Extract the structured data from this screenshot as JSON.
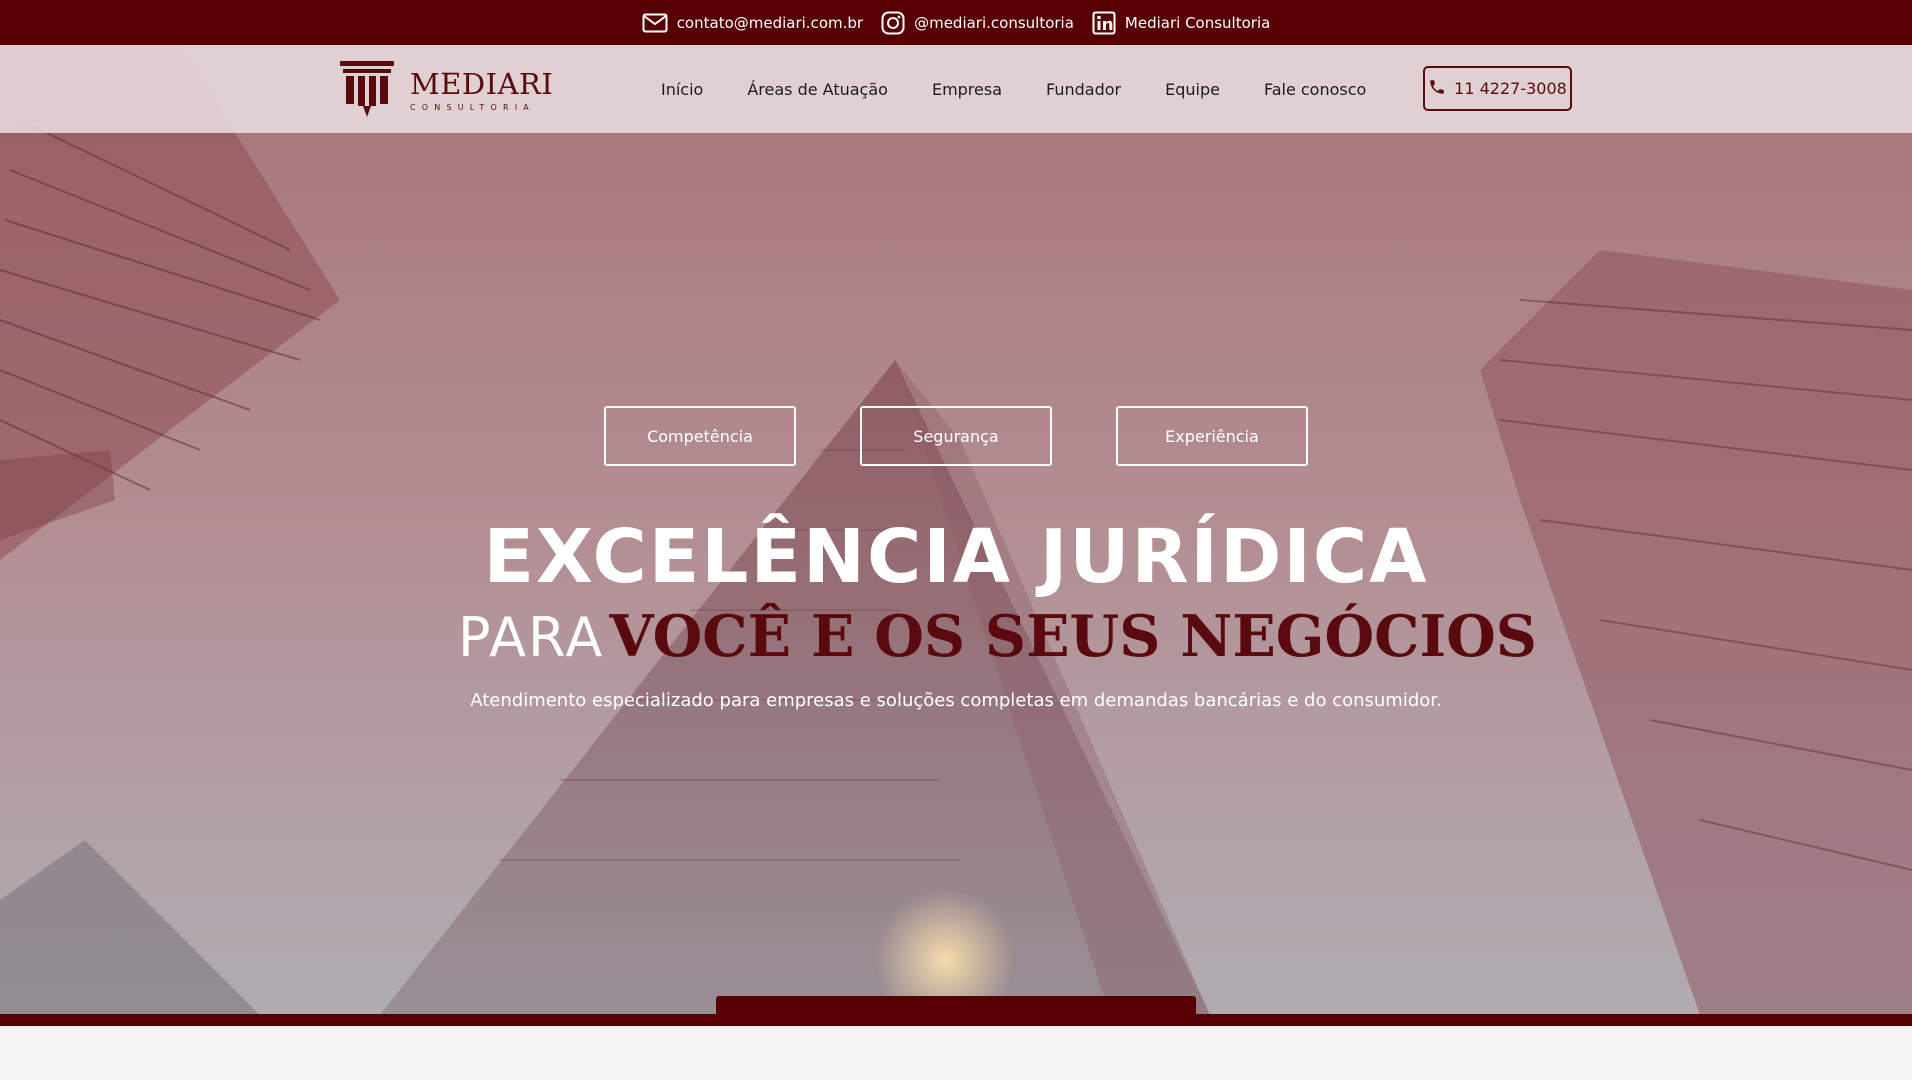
{
  "topbar": {
    "email": "contato@mediari.com.br",
    "instagram": "@mediari.consultoria",
    "linkedin": "Mediari Consultoria",
    "icons": [
      "mail-icon",
      "instagram-icon",
      "linkedin-icon"
    ]
  },
  "logo": {
    "name": "MEDIARI",
    "subtitle": "CONSULTORIA"
  },
  "nav": {
    "items": [
      {
        "label": "Início"
      },
      {
        "label": "Áreas de Atuação"
      },
      {
        "label": "Empresa"
      },
      {
        "label": "Fundador"
      },
      {
        "label": "Equipe"
      },
      {
        "label": "Fale conosco"
      }
    ],
    "phone": "11 4227-3008",
    "phone_icon": "phone-icon"
  },
  "hero": {
    "pills": [
      "Competência",
      "Segurança",
      "Experiência"
    ],
    "headline": "EXCELÊNCIA JURÍDICA",
    "sub_prefix": "PARA",
    "sub_accent": "VOCÊ E OS SEUS NEGÓCIOS",
    "tagline": "Atendimento especializado para empresas e soluções completas em demandas bancárias e do consumidor."
  },
  "colors": {
    "brand": "#560003",
    "accent": "#5a0a0f",
    "hero_top": "#a47479",
    "hero_bottom": "#b0acb0",
    "text_light": "#ffffff"
  }
}
